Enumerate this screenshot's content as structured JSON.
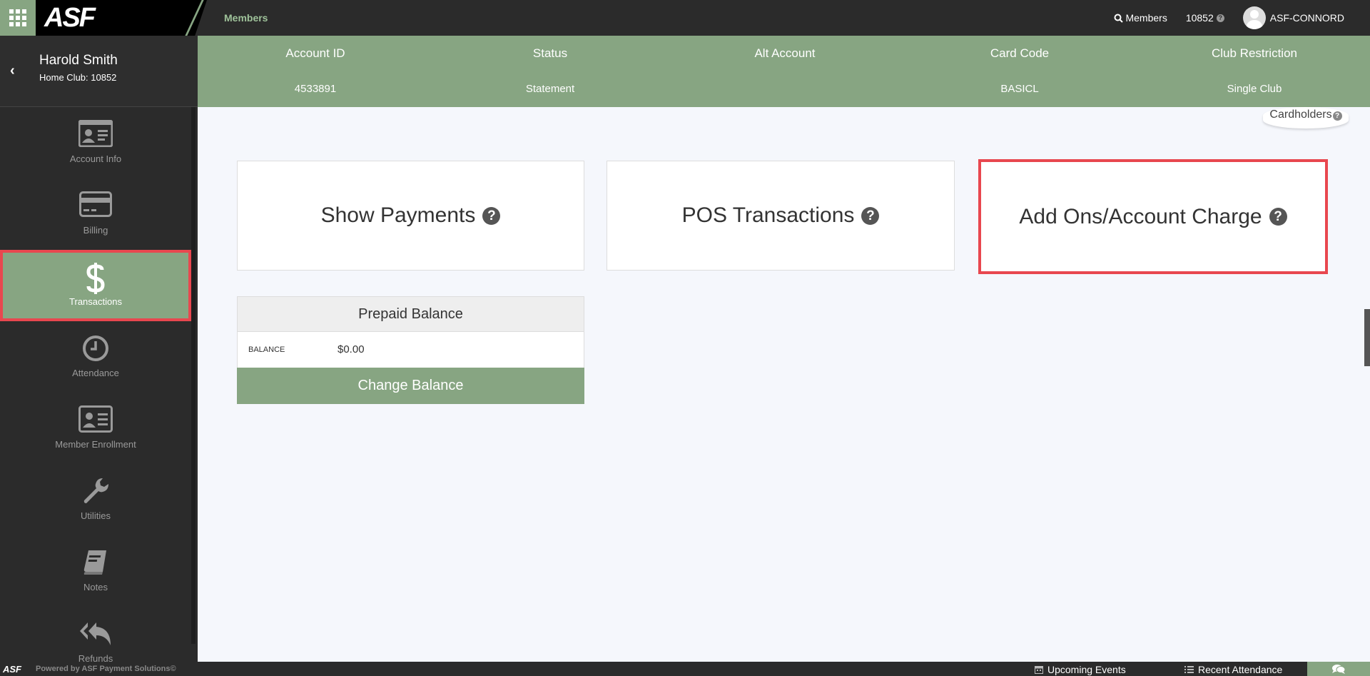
{
  "topbar": {
    "logo": "ASF",
    "breadcrumb": "Members",
    "members_label": "Members",
    "club_id": "10852",
    "user": "ASF-CONNORD"
  },
  "member": {
    "name": "Harold Smith",
    "home_club": "Home Club: 10852"
  },
  "account": {
    "columns": [
      {
        "label": "Account ID",
        "value": "4533891"
      },
      {
        "label": "Status",
        "value": "Statement"
      },
      {
        "label": "Alt Account",
        "value": ""
      },
      {
        "label": "Card Code",
        "value": "BASICL"
      },
      {
        "label": "Club Restriction",
        "value": "Single Club"
      }
    ]
  },
  "sidebar": {
    "items": [
      {
        "label": "Account Info",
        "icon": "id-card-icon"
      },
      {
        "label": "Billing",
        "icon": "credit-card-icon"
      },
      {
        "label": "Transactions",
        "icon": "dollar-icon",
        "active": true
      },
      {
        "label": "Attendance",
        "icon": "clock-icon"
      },
      {
        "label": "Member Enrollment",
        "icon": "enrollment-icon"
      },
      {
        "label": "Utilities",
        "icon": "wrench-icon"
      },
      {
        "label": "Notes",
        "icon": "book-icon"
      },
      {
        "label": "Refunds",
        "icon": "reply-all-icon"
      }
    ]
  },
  "cardholders": "Cardholders",
  "cards": [
    {
      "label": "Show Payments"
    },
    {
      "label": "POS Transactions"
    },
    {
      "label": "Add Ons/Account Charge",
      "highlighted": true
    }
  ],
  "prepaid": {
    "title": "Prepaid Balance",
    "balance_label": "BALANCE",
    "balance_value": "$0.00",
    "button": "Change Balance"
  },
  "footer": {
    "brand": "ASF",
    "powered": "Powered by ASF Payment Solutions©",
    "upcoming_events": "Upcoming Events",
    "recent_attendance": "Recent Attendance"
  },
  "colors": {
    "accent": "#87a582",
    "dark": "#2b2b2b",
    "highlight": "#e8474f"
  }
}
